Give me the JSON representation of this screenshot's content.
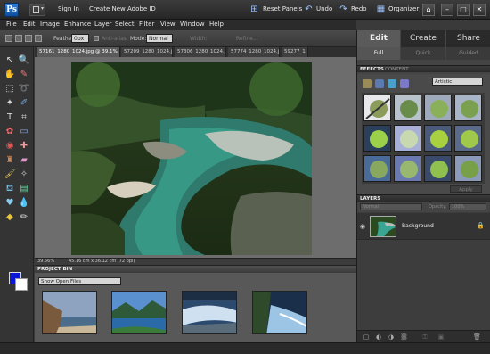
{
  "topbar": {
    "logo": "Ps",
    "sign_in": "Sign In",
    "create_id": "Create New Adobe ID",
    "reset_panels": "Reset Panels",
    "undo": "Undo",
    "redo": "Redo",
    "organizer": "Organizer"
  },
  "menu": [
    "File",
    "Edit",
    "Image",
    "Enhance",
    "Layer",
    "Select",
    "Filter",
    "View",
    "Window",
    "Help"
  ],
  "options": {
    "feather_label": "Feather:",
    "feather_value": "0px",
    "anti_alias": "Anti-alias",
    "mode_label": "Mode:",
    "mode_value": "Normal",
    "width_label": "Width:",
    "refine": "Refine..."
  },
  "doc_tabs": [
    "57161_1280_1024.jpg @ 39.1% (RGB/8) *",
    "57209_1280_1024.jpg",
    "57306_1280_1024.jpg",
    "57774_1280_1024.jpg",
    "59277_1"
  ],
  "status": {
    "zoom": "39.56%",
    "size": "45.16 cm x 36.12 cm (72 ppi)"
  },
  "project_bin": {
    "title": "PROJECT BIN",
    "show": "Show Open Files"
  },
  "right_panel": {
    "mode_tabs": [
      "Edit",
      "Create",
      "Share"
    ],
    "sub_tabs": [
      "Full",
      "Quick",
      "Guided"
    ],
    "effects_tab": "EFFECTS",
    "content_tab": "CONTENT",
    "effects_filter": "Artistic",
    "apply": "Apply",
    "layers_title": "LAYERS",
    "blend_mode": "Normal",
    "opacity_label": "Opacity:",
    "opacity_value": "100%",
    "layer_name": "Background"
  }
}
